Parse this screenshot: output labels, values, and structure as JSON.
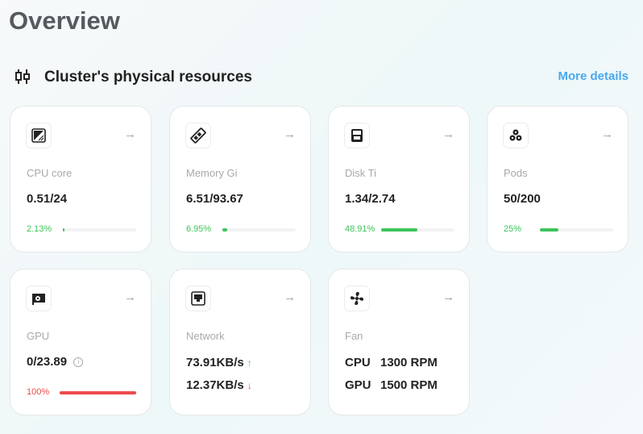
{
  "page": {
    "title": "Overview"
  },
  "section": {
    "title": "Cluster's physical resources",
    "more_details": "More details"
  },
  "cards": [
    {
      "icon": "cpu-icon",
      "label": "CPU core",
      "value": "0.51/24",
      "percent_label": "2.13%",
      "percent": 2.13,
      "color": "#3ec45a"
    },
    {
      "icon": "memory-icon",
      "label": "Memory Gi",
      "value": "6.51/93.67",
      "percent_label": "6.95%",
      "percent": 6.95,
      "color": "#3ec45a"
    },
    {
      "icon": "disk-icon",
      "label": "Disk Ti",
      "value": "1.34/2.74",
      "percent_label": "48.91%",
      "percent": 48.91,
      "color": "#3ec45a"
    },
    {
      "icon": "pods-icon",
      "label": "Pods",
      "value": "50/200",
      "percent_label": "25%",
      "percent": 25,
      "color": "#3ec45a"
    },
    {
      "icon": "gpu-icon",
      "label": "GPU",
      "value": "0/23.89",
      "percent_label": "100%",
      "percent": 100,
      "color": "#ec4b4b"
    }
  ],
  "network": {
    "icon": "network-icon",
    "label": "Network",
    "up": "73.91KB/s",
    "down": "12.37KB/s",
    "up_color": "#3ec45a",
    "down_color": "#ec4b4b"
  },
  "fan": {
    "icon": "fan-icon",
    "label": "Fan",
    "rows": [
      {
        "name": "CPU",
        "value": "1300 RPM"
      },
      {
        "name": "GPU",
        "value": "1500 RPM"
      }
    ]
  }
}
